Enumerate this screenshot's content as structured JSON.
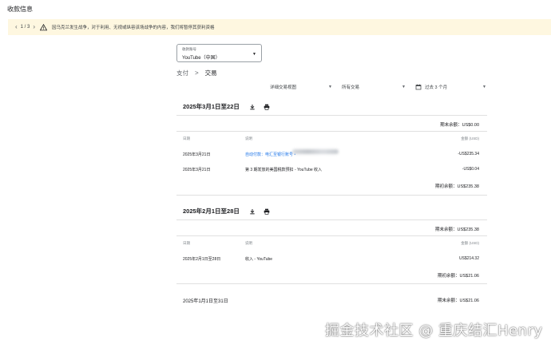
{
  "page_title": "收款信息",
  "alert": {
    "pager": "1 / 3",
    "message": "因乌克兰发生战争，对于利用、无视或纵容该场战争的内容，我们将暂停其获利资格"
  },
  "account": {
    "label": "收款账号",
    "value": "YouTube（中国）"
  },
  "breadcrumb": {
    "parent": "支付",
    "separator": ">",
    "current": "交易"
  },
  "filters": {
    "view": "详细交易视图",
    "type": "所有交易",
    "range": "过去 3 个月"
  },
  "icons": {
    "download": "download-icon",
    "print": "print-icon",
    "calendar": "calendar-icon",
    "warning": "warning-icon"
  },
  "periods": [
    {
      "title": "2025年3月1日至22日",
      "closing_balance": "期末余额：US$0.00",
      "col_date": "日期",
      "col_desc": "说明",
      "col_amount": "金额 (USD)",
      "rows": [
        {
          "date": "2025年3月21日",
          "desc": "自动付款：电汇至银行账号 •",
          "amount": "-US$235.34"
        },
        {
          "date": "2025年3月21日",
          "desc": "第 3 期发放的美国税款预扣 - YouTube 收入",
          "amount": "-US$0.04"
        }
      ],
      "opening_balance": "期初余额：US$235.38"
    },
    {
      "title": "2025年2月1日至28日",
      "closing_balance": "期末余额：US$235.38",
      "col_date": "日期",
      "col_desc": "说明",
      "col_amount": "金额 (USD)",
      "rows": [
        {
          "date": "2025年2月1日至28日",
          "desc": "收入 - YouTube",
          "amount": "US$214.32"
        }
      ],
      "opening_balance": "期初余额：US$21.06"
    },
    {
      "title": "2025年1月1日至31日",
      "closing_balance": "期末余额：US$21.06"
    }
  ],
  "watermark": "掘金技术社区 @ 重庆结汇Henry"
}
